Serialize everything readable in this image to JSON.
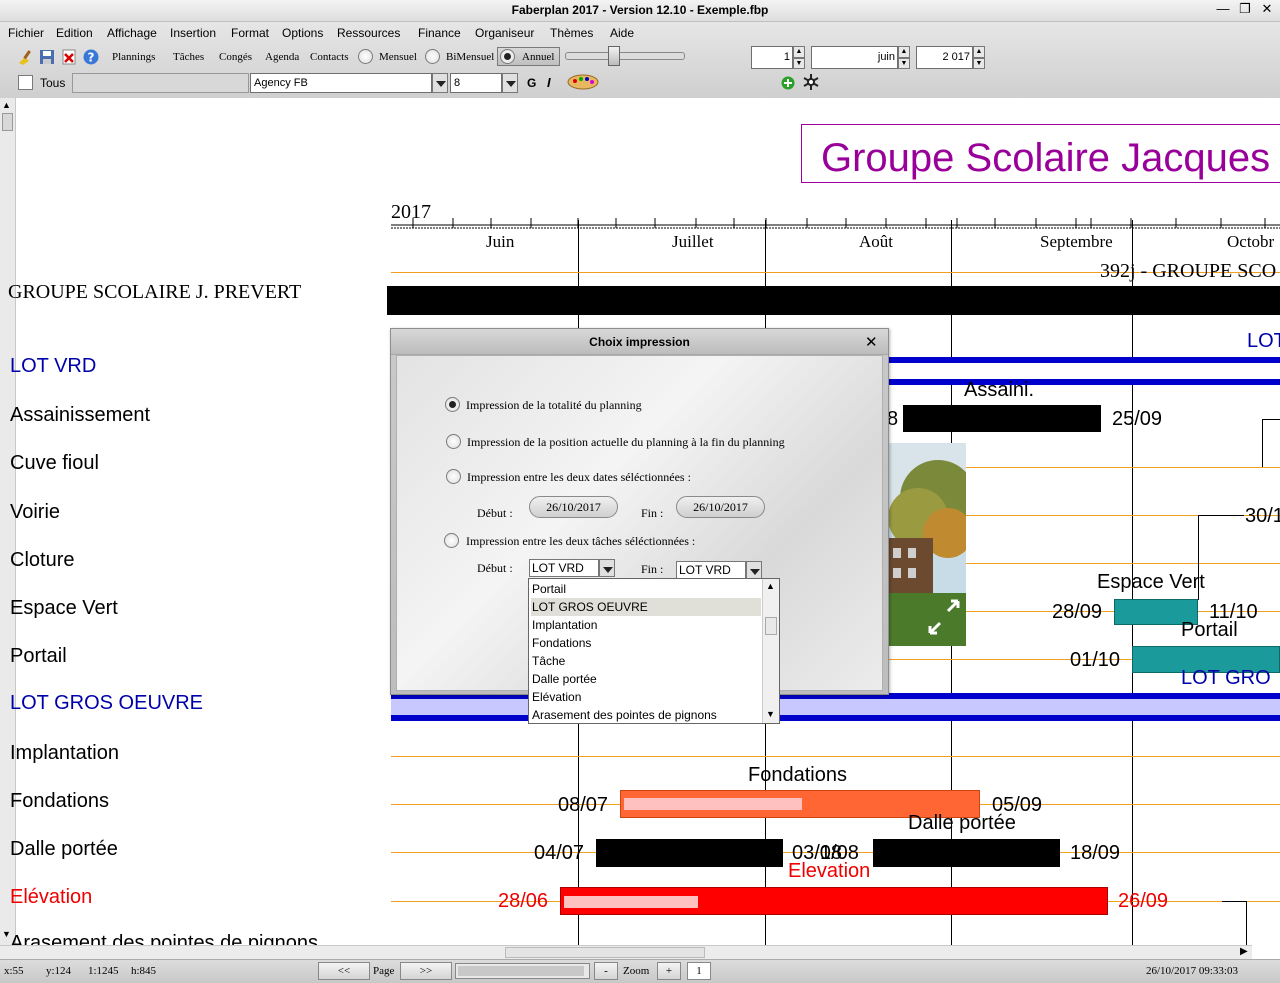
{
  "window": {
    "title": "Faberplan 2017 - Version 12.10 - Exemple.fbp",
    "minimize_glyph": "—",
    "restore_glyph": "❐",
    "close_glyph": "✕"
  },
  "menu": {
    "items": [
      "Fichier",
      "Edition",
      "Affichage",
      "Insertion",
      "Format",
      "Options",
      "Ressources",
      "Finance",
      "Organiseur",
      "Thèmes",
      "Aide"
    ]
  },
  "toolbar": {
    "links": [
      "Plannings",
      "Tâches",
      "Congés",
      "Agenda",
      "Contacts"
    ],
    "view_modes": [
      {
        "label": "Mensuel",
        "selected": false
      },
      {
        "label": "BiMensuel",
        "selected": false
      },
      {
        "label": "Annuel",
        "selected": true
      }
    ],
    "zoom_slider_level": 0.4,
    "date_day": "1",
    "date_month": "juin",
    "date_year": "2 017",
    "tous_label": "Tous",
    "font_name": "Agency FB",
    "font_size": "8",
    "bold_glyph": "G",
    "italic_glyph": "I",
    "icons": [
      "broom-icon",
      "save-icon",
      "delete-icon",
      "help-icon",
      "palette-icon",
      "add-icon",
      "snowflake-icon"
    ]
  },
  "canvas": {
    "project_title": "Groupe Scolaire Jacques",
    "year": "2017",
    "months": [
      "Juin",
      "Juillet",
      "Août",
      "Septembre",
      "Octobr"
    ],
    "summary_label": "392j - GROUPE SCO",
    "rows": [
      {
        "label": "GROUPE SCOLAIRE J. PREVERT",
        "color": "#000000",
        "serif": true
      },
      {
        "label": "LOT VRD",
        "color": "#0000aa"
      },
      {
        "label": "Assainissement",
        "color": "#000000"
      },
      {
        "label": "Cuve fioul",
        "color": "#000000"
      },
      {
        "label": "Voirie",
        "color": "#000000"
      },
      {
        "label": "Cloture",
        "color": "#000000"
      },
      {
        "label": "Espace Vert",
        "color": "#000000"
      },
      {
        "label": "Portail",
        "color": "#000000"
      },
      {
        "label": "LOT GROS OEUVRE",
        "color": "#0000aa"
      },
      {
        "label": "Implantation",
        "color": "#000000"
      },
      {
        "label": "Fondations",
        "color": "#000000"
      },
      {
        "label": "Dalle portée",
        "color": "#000000"
      },
      {
        "label": "Elévation",
        "color": "#ee0000"
      },
      {
        "label": "Arasement des pointes  de pignons",
        "color": "#000000"
      }
    ],
    "task_labels": {
      "lot_vrd": "LOT",
      "assaini": "Assaini.",
      "assaini_start_fragment": "8",
      "assaini_end": "25/09",
      "voirie_end": "30/1",
      "espace_vert": "Espace Vert",
      "espace_vert_start": "28/09",
      "espace_vert_end": "11/10",
      "portail": "Portail",
      "portail_start": "01/10",
      "lot_gros_oeuvre": "LOT GRO",
      "fondations": "Fondations",
      "fondations_start": "08/07",
      "fondations_end": "05/09",
      "dalle": "Dalle portée",
      "dalle_start": "04/07",
      "dalle_mid": "03/08",
      "dalle_mid2": "1/08",
      "dalle_end": "18/09",
      "elevation": "Elevation",
      "elevation_start": "28/06",
      "elevation_end": "26/09"
    }
  },
  "dialog": {
    "title": "Choix impression",
    "close_glyph": "✕",
    "options": [
      {
        "label": "Impression de la totalité du planning",
        "selected": true
      },
      {
        "label": "Impression de la position actuelle du planning à la fin du planning",
        "selected": false
      },
      {
        "label": "Impression entre les deux dates séléctionnées :",
        "selected": false
      },
      {
        "label": "Impression entre les deux tâches séléctionnées :",
        "selected": false
      }
    ],
    "debut_label": "Début :",
    "fin_label": "Fin :",
    "date_start": "26/10/2017",
    "date_end": "26/10/2017",
    "task_start": "LOT VRD",
    "task_end": "LOT VRD",
    "dropdown_items": [
      {
        "label": "Portail",
        "selected": false
      },
      {
        "label": "LOT GROS OEUVRE",
        "selected": true
      },
      {
        "label": "Implantation",
        "selected": false
      },
      {
        "label": "Fondations",
        "selected": false
      },
      {
        "label": "Tâche",
        "selected": false
      },
      {
        "label": "Dalle portée",
        "selected": false
      },
      {
        "label": "Elévation",
        "selected": false
      },
      {
        "label": "Arasement des pointes  de pignons",
        "selected": false
      }
    ]
  },
  "status": {
    "x": "x:55",
    "y": "y:124",
    "scale": "1:1245",
    "h": "h:845",
    "prev": "<<",
    "page_label": "Page",
    "next": ">>",
    "zoom_minus": "-",
    "zoom_label": "Zoom",
    "zoom_plus": "+",
    "zoom_value": "1",
    "datetime": "26/10/2017 09:33:03"
  }
}
